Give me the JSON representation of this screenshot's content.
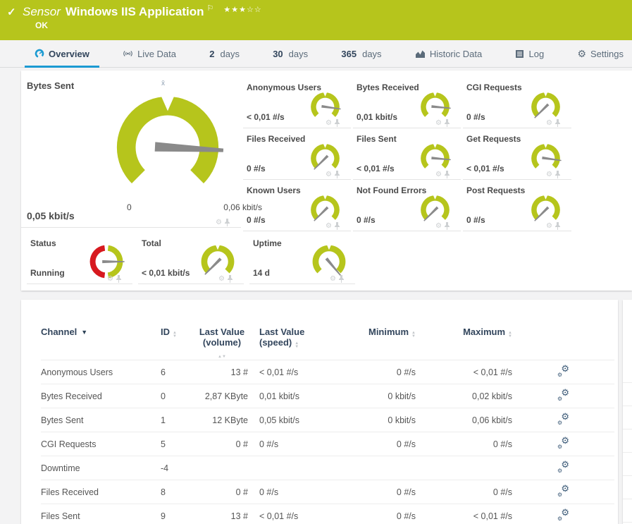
{
  "colors": {
    "brand_green": "#b6c51c",
    "status_red": "#d7191f",
    "tab_active_blue": "#1b9ad2",
    "header_navy": "#32455c",
    "needle_gray": "#8a8a8a"
  },
  "header": {
    "kind_label": "Sensor",
    "title": "Windows IIS Application",
    "status": "OK",
    "stars_filled": "★★★",
    "stars_empty": "☆☆",
    "flag": "⚐",
    "check": "✓"
  },
  "tabs": [
    {
      "label": "Overview",
      "active": true
    },
    {
      "label": "Live Data"
    },
    {
      "num": "2",
      "label": "days"
    },
    {
      "num": "30",
      "label": "days"
    },
    {
      "num": "365",
      "label": "days"
    },
    {
      "label": "Historic Data"
    },
    {
      "label": "Log"
    },
    {
      "label": "Settings"
    }
  ],
  "gauges": {
    "big": {
      "title": "Bytes Sent",
      "value": "0,05 kbit/s",
      "scale_min": "0",
      "scale_max": "0,06 kbit/s",
      "avg_marker": "x̄",
      "needle_deg": 3
    },
    "grid": [
      {
        "title": "Anonymous Users",
        "value": "< 0,01 #/s",
        "needle_deg": 8
      },
      {
        "title": "Bytes Received",
        "value": "0,01 kbit/s",
        "needle_deg": 5
      },
      {
        "title": "CGI Requests",
        "value": "0 #/s",
        "needle_deg": 135
      },
      {
        "title": "Files Received",
        "value": "0 #/s",
        "needle_deg": 135
      },
      {
        "title": "Files Sent",
        "value": "< 0,01 #/s",
        "needle_deg": 5
      },
      {
        "title": "Get Requests",
        "value": "< 0,01 #/s",
        "needle_deg": 8
      },
      {
        "title": "Known Users",
        "value": "0 #/s",
        "needle_deg": 135
      },
      {
        "title": "Not Found Errors",
        "value": "0 #/s",
        "needle_deg": 135
      },
      {
        "title": "Post Requests",
        "value": "0 #/s",
        "needle_deg": 135
      }
    ],
    "bottom": [
      {
        "title": "Status",
        "value": "Running",
        "type": "status",
        "needle_deg": 0
      },
      {
        "title": "Total",
        "value": "< 0,01 kbit/s",
        "needle_deg": 135
      },
      {
        "title": "Uptime",
        "value": "14 d",
        "needle_deg": 50
      }
    ]
  },
  "table": {
    "columns": {
      "channel": "Channel",
      "id": "ID",
      "last_volume_1": "Last Value",
      "last_volume_2": "(volume)",
      "last_speed_1": "Last Value",
      "last_speed_2": "(speed)",
      "minimum": "Minimum",
      "maximum": "Maximum"
    },
    "rows": [
      {
        "channel": "Anonymous Users",
        "id": "6",
        "last_volume": "13 #",
        "last_speed": "< 0,01 #/s",
        "min": "0 #/s",
        "max": "< 0,01 #/s"
      },
      {
        "channel": "Bytes Received",
        "id": "0",
        "last_volume": "2,87 KByte",
        "last_speed": "0,01 kbit/s",
        "min": "0 kbit/s",
        "max": "0,02 kbit/s"
      },
      {
        "channel": "Bytes Sent",
        "id": "1",
        "last_volume": "12 KByte",
        "last_speed": "0,05 kbit/s",
        "min": "0 kbit/s",
        "max": "0,06 kbit/s"
      },
      {
        "channel": "CGI Requests",
        "id": "5",
        "last_volume": "0 #",
        "last_speed": "0 #/s",
        "min": "0 #/s",
        "max": "0 #/s"
      },
      {
        "channel": "Downtime",
        "id": "-4",
        "last_volume": "",
        "last_speed": "",
        "min": "",
        "max": ""
      },
      {
        "channel": "Files Received",
        "id": "8",
        "last_volume": "0 #",
        "last_speed": "0 #/s",
        "min": "0 #/s",
        "max": "0 #/s"
      },
      {
        "channel": "Files Sent",
        "id": "9",
        "last_volume": "13 #",
        "last_speed": "< 0,01 #/s",
        "min": "0 #/s",
        "max": "< 0,01 #/s"
      }
    ]
  }
}
